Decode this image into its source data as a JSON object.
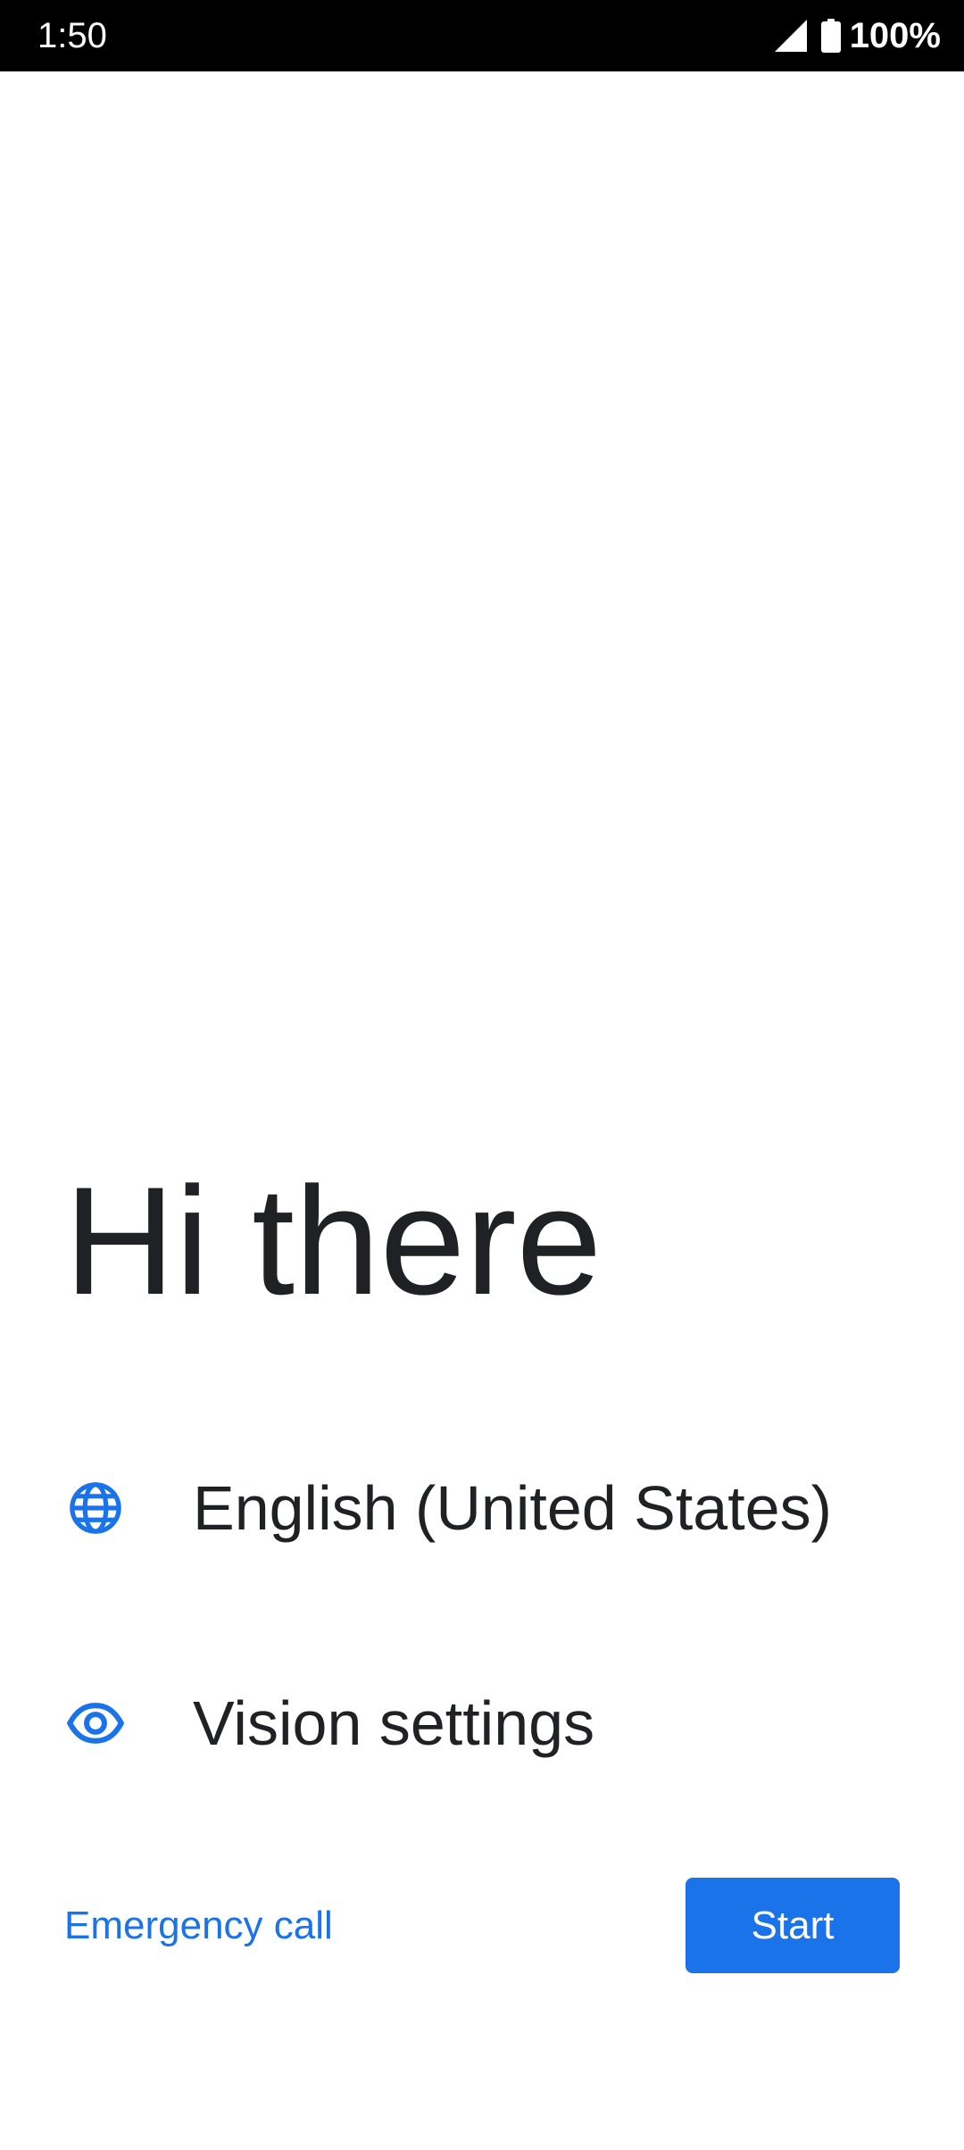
{
  "status_bar": {
    "time": "1:50",
    "battery": "100%",
    "icons": [
      "signal-icon",
      "battery-icon"
    ]
  },
  "welcome": {
    "title": "Hi there"
  },
  "options": [
    {
      "label": "English (United States)",
      "icon": "globe-icon"
    },
    {
      "label": "Vision settings",
      "icon": "eye-icon"
    }
  ],
  "actions": {
    "emergency_label": "Emergency call",
    "start_label": "Start"
  },
  "colors": {
    "accent": "#1a73e8",
    "text": "#202124",
    "status_bar_bg": "#000000",
    "background": "#ffffff"
  }
}
